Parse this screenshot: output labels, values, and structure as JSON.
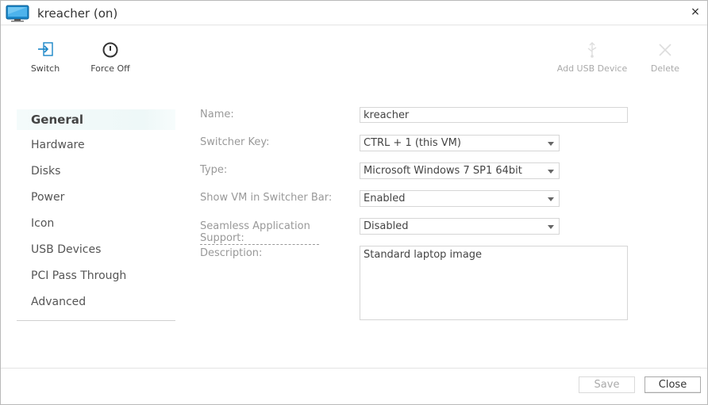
{
  "window": {
    "title": "kreacher (on)",
    "close_glyph": "×"
  },
  "toolbar": {
    "switch_label": "Switch",
    "force_off_label": "Force Off",
    "add_usb_label": "Add USB Device",
    "delete_label": "Delete"
  },
  "sidebar": {
    "items": [
      {
        "label": "General",
        "active": true
      },
      {
        "label": "Hardware"
      },
      {
        "label": "Disks"
      },
      {
        "label": "Power"
      },
      {
        "label": "Icon"
      },
      {
        "label": "USB Devices"
      },
      {
        "label": "PCI Pass Through"
      },
      {
        "label": "Advanced"
      }
    ]
  },
  "form": {
    "name_label": "Name:",
    "name_value": "kreacher",
    "switcher_key_label": "Switcher Key:",
    "switcher_key_value": "CTRL + 1 (this VM)",
    "type_label": "Type:",
    "type_value": "Microsoft Windows 7 SP1 64bit",
    "show_vm_label": "Show VM in Switcher Bar:",
    "show_vm_value": "Enabled",
    "seamless_label": "Seamless Application Support:",
    "seamless_value": "Disabled",
    "description_label": "Description:",
    "description_value": "Standard laptop image"
  },
  "footer": {
    "save_label": "Save",
    "close_label": "Close"
  },
  "colors": {
    "accent": "#1a86c8",
    "disabled_text": "#aaaaaa"
  }
}
